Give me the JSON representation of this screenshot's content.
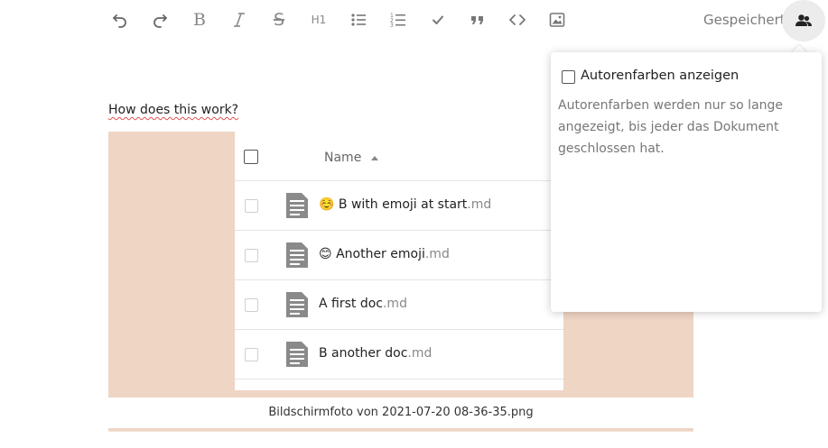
{
  "toolbar": {
    "buttons": [
      {
        "name": "undo-icon"
      },
      {
        "name": "redo-icon"
      },
      {
        "name": "bold-icon",
        "glyph": "B"
      },
      {
        "name": "italic-icon"
      },
      {
        "name": "strikethrough-icon",
        "glyph": "S"
      },
      {
        "name": "heading-icon",
        "glyph": "H1"
      },
      {
        "name": "bullet-list-icon"
      },
      {
        "name": "numbered-list-icon"
      },
      {
        "name": "checklist-icon"
      },
      {
        "name": "blockquote-icon",
        "glyph": "99"
      },
      {
        "name": "code-icon"
      },
      {
        "name": "image-icon"
      }
    ],
    "status_label": "Gespeichert",
    "users_button_icon": "users-icon"
  },
  "document": {
    "help_link": "How does this work?",
    "image_caption": "Bildschirmfoto von 2021-07-20 08-36-35.png",
    "file_list": {
      "header_name": "Name",
      "rows": [
        {
          "emoji": "☺️",
          "name": "B with emoji at start",
          "ext": ".md",
          "icon": "document-icon"
        },
        {
          "emoji": "😊",
          "name": "Another emoji",
          "ext": ".md",
          "icon": "document-icon"
        },
        {
          "emoji": "",
          "name": "A first doc",
          "ext": ".md",
          "icon": "document-icon"
        },
        {
          "emoji": "",
          "name": "B another doc",
          "ext": ".md",
          "icon": "document-icon"
        }
      ]
    }
  },
  "popover": {
    "checkbox_label": "Autorenfarben anzeigen",
    "checkbox_checked": false,
    "description": "Autorenfarben werden nur so lange angezeigt, bis jeder das Dokument geschlossen hat."
  },
  "colors": {
    "image_background": "#efd5c4",
    "icon_gray": "#777777",
    "document_icon": "#8a8a8a"
  }
}
